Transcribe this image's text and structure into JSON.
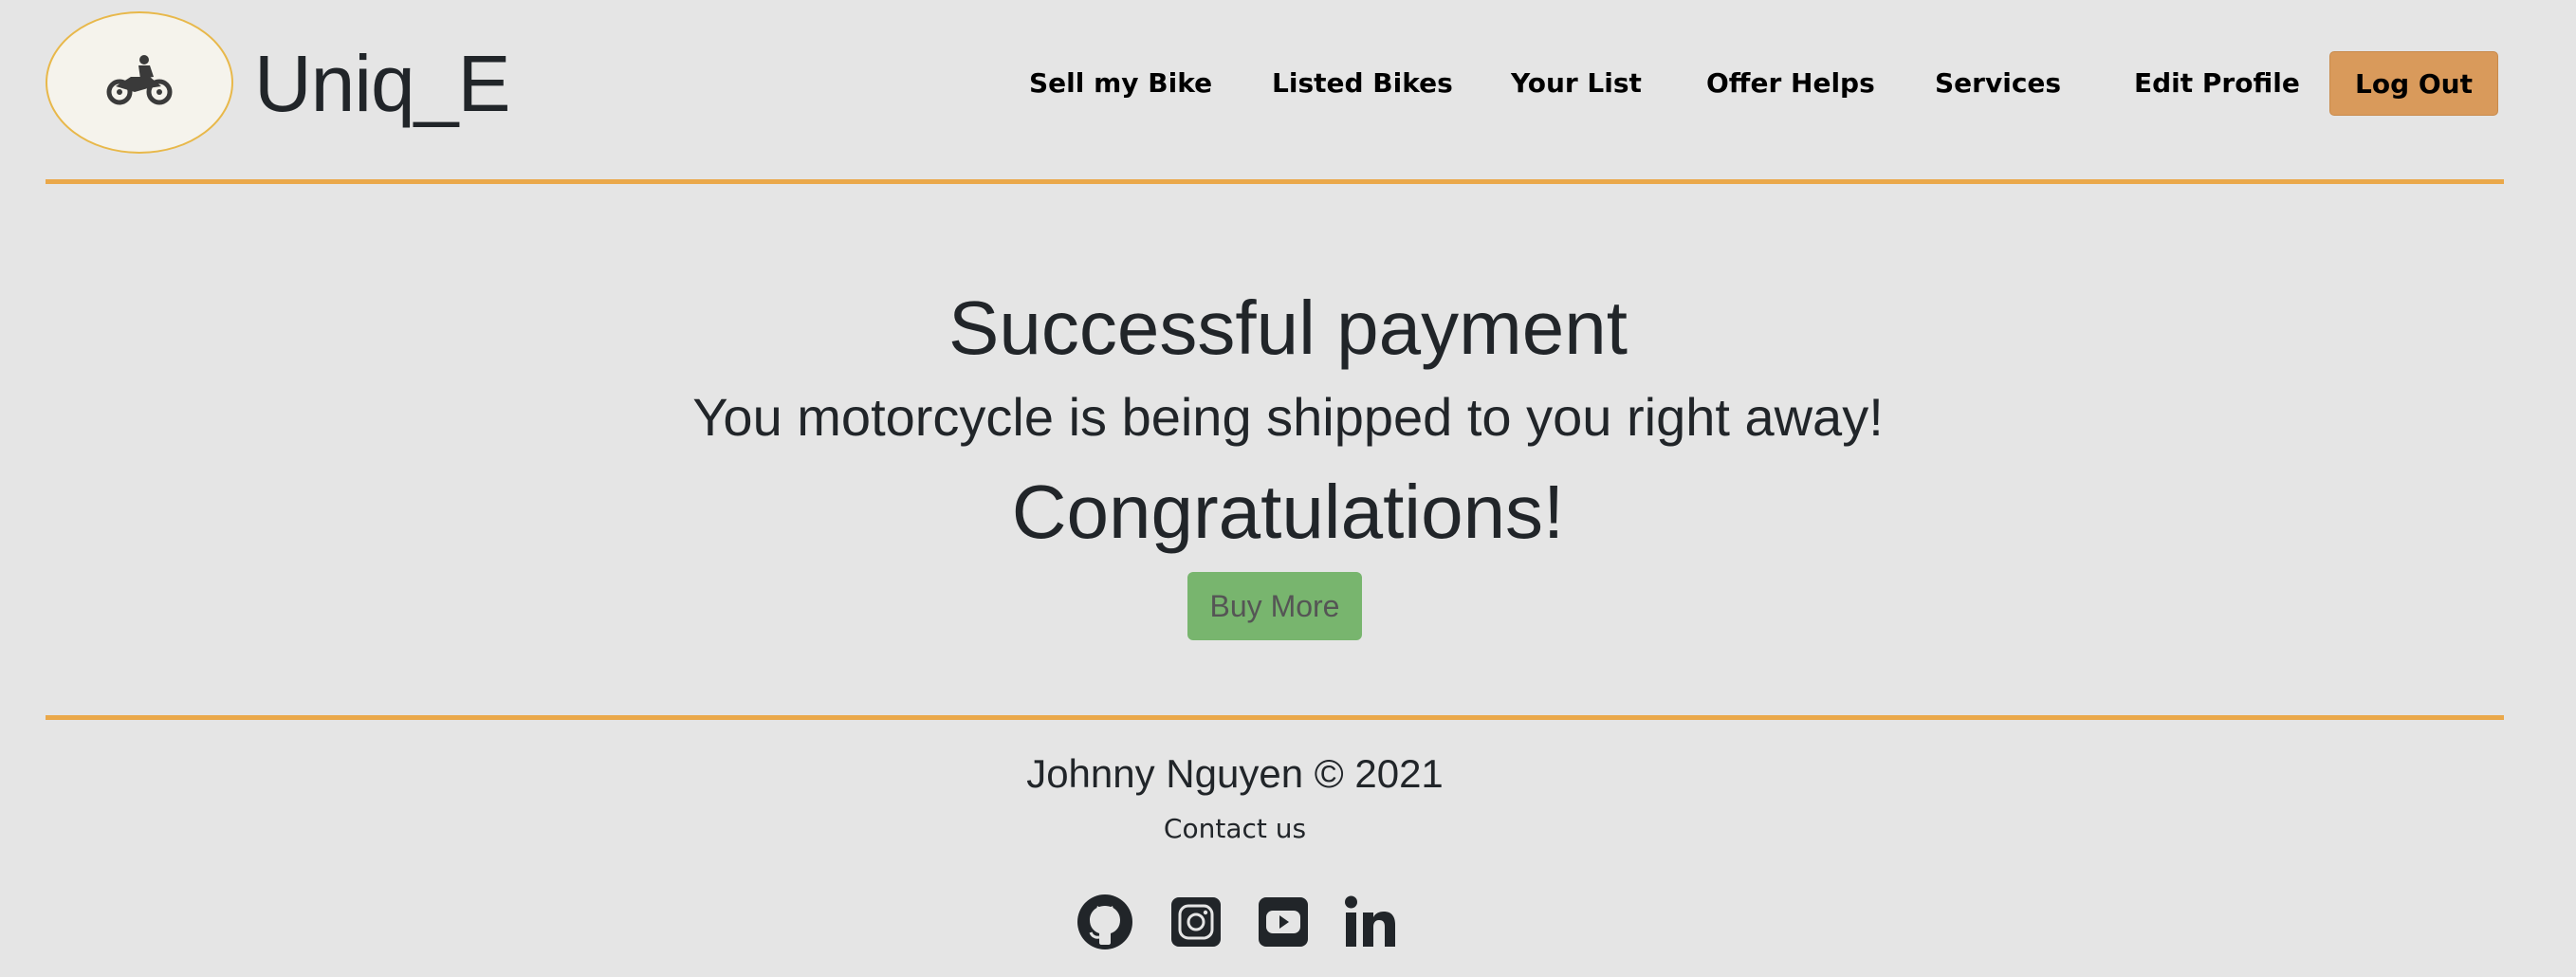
{
  "brand": {
    "name": "Uniq_E",
    "logo_icon": "motorcycle-icon"
  },
  "nav": {
    "items": [
      {
        "label": "Sell my Bike"
      },
      {
        "label": "Listed Bikes"
      },
      {
        "label": "Your List"
      },
      {
        "label": "Offer Helps"
      },
      {
        "label": "Services"
      },
      {
        "label": "Edit Profile"
      }
    ],
    "logout_label": "Log Out"
  },
  "main": {
    "title": "Successful payment",
    "subtitle": "You motorcycle is being shipped to you right away!",
    "congrats": "Congratulations!",
    "buy_more_label": "Buy More"
  },
  "footer": {
    "credit": "Johnny Nguyen © 2021",
    "contact": "Contact us",
    "social_icons": [
      "github-icon",
      "instagram-icon",
      "youtube-icon",
      "linkedin-icon"
    ]
  },
  "colors": {
    "accent_rule": "#eaa84a",
    "logout_bg": "#d99a5b",
    "buy_more_bg": "#78b56e",
    "page_bg": "#e5e5e5"
  }
}
